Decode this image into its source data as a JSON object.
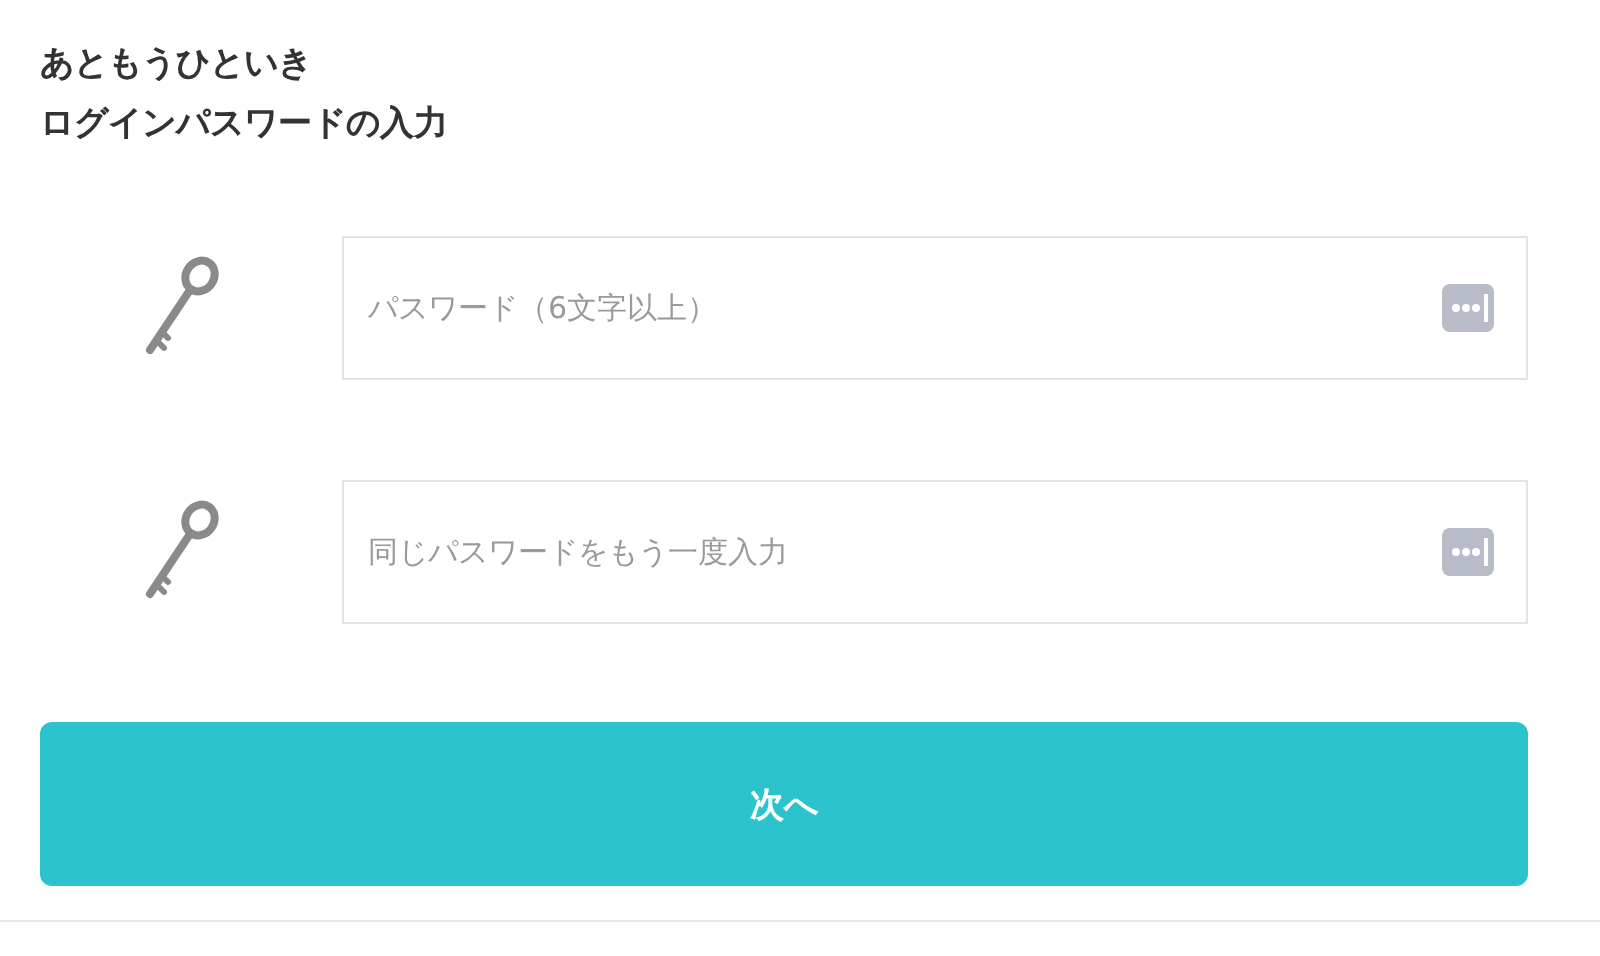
{
  "heading": [
    "あともうひといき",
    "ログインパスワードの入力"
  ],
  "fields": [
    {
      "placeholder": "パスワード（6文字以上）"
    },
    {
      "placeholder": "同じパスワードをもう一度入力"
    }
  ],
  "button": "次へ"
}
